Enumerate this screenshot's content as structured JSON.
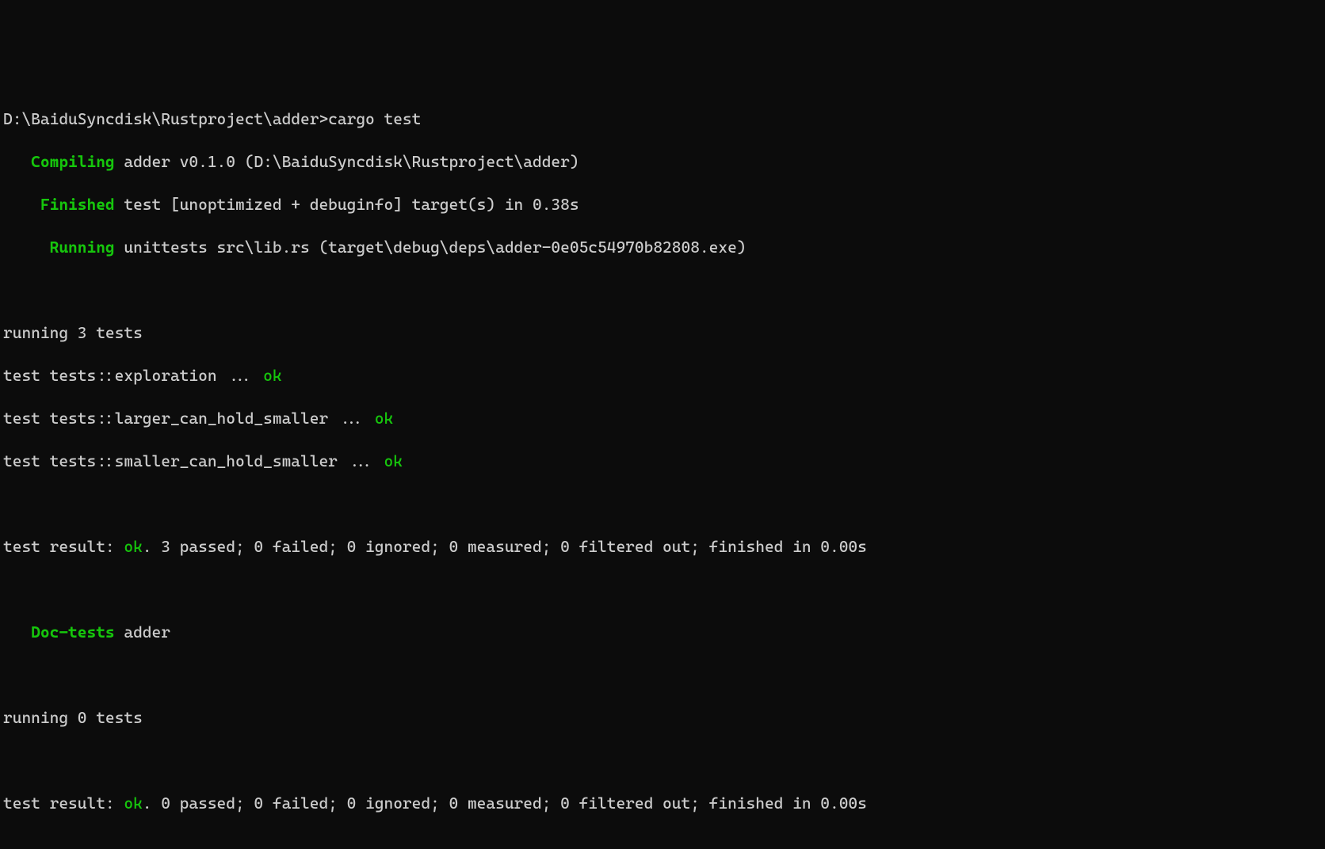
{
  "prompt": {
    "path": "D:\\BaiduSyncdisk\\Rustproject\\adder>",
    "command": "cargo test"
  },
  "build": {
    "compiling_label": "Compiling",
    "compiling_text": " adder v0.1.0 (D:\\BaiduSyncdisk\\Rustproject\\adder)",
    "finished_label": "Finished",
    "finished_text": " test [unoptimized + debuginfo] target(s) in 0.38s",
    "running_label": "Running",
    "running_text": " unittests src\\lib.rs (target\\debug\\deps\\adder-0e05c54970b82808.exe)"
  },
  "test_run1": {
    "header": "running 3 tests",
    "tests": [
      {
        "prefix": "test tests::exploration ... ",
        "status": "ok"
      },
      {
        "prefix": "test tests::larger_can_hold_smaller ... ",
        "status": "ok"
      },
      {
        "prefix": "test tests::smaller_can_hold_smaller ... ",
        "status": "ok"
      }
    ],
    "result_prefix": "test result: ",
    "result_status": "ok",
    "result_suffix": ". 3 passed; 0 failed; 0 ignored; 0 measured; 0 filtered out; finished in 0.00s"
  },
  "doc_tests": {
    "label": "Doc-tests",
    "text": " adder"
  },
  "test_run2": {
    "header": "running 0 tests",
    "result_prefix": "test result: ",
    "result_status": "ok",
    "result_suffix": ". 0 passed; 0 failed; 0 ignored; 0 measured; 0 filtered out; finished in 0.00s"
  },
  "spacing": {
    "pad3": "   ",
    "pad4": "    ",
    "pad5": "     "
  }
}
